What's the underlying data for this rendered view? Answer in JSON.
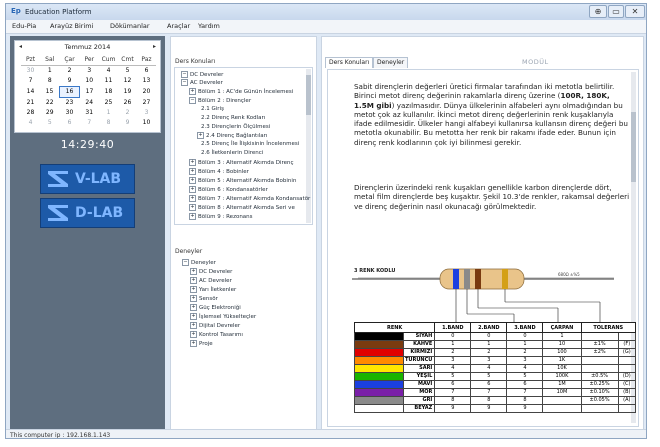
{
  "window": {
    "title": "Education Platform",
    "buttons": [
      "⊕",
      "▭",
      "✕"
    ]
  },
  "menu": [
    "Edu-Pia",
    "Arayüz Birimi",
    "Dökümanlar",
    "Araçlar",
    "Yardım"
  ],
  "calendar": {
    "month_title": "Temmuz 2014",
    "days": [
      "Pzt",
      "Sal",
      "Çar",
      "Per",
      "Cum",
      "Cmt",
      "Paz"
    ],
    "weeks": [
      [
        "30",
        "1",
        "2",
        "3",
        "4",
        "5",
        "6"
      ],
      [
        "7",
        "8",
        "9",
        "10",
        "11",
        "12",
        "13"
      ],
      [
        "14",
        "15",
        "16",
        "17",
        "18",
        "19",
        "20"
      ],
      [
        "21",
        "22",
        "23",
        "24",
        "25",
        "26",
        "27"
      ],
      [
        "28",
        "29",
        "30",
        "31",
        "1",
        "2",
        "3"
      ],
      [
        "4",
        "5",
        "6",
        "7",
        "8",
        "9",
        "10"
      ]
    ]
  },
  "clock": "14:29:40",
  "labs": [
    {
      "label": "V-LAB"
    },
    {
      "label": "D-LAB"
    }
  ],
  "course_tree": {
    "title": "Ders Konuları",
    "items": [
      {
        "text": "DC Devreler",
        "exp": "⊟"
      },
      {
        "text": "AC Devreler",
        "exp": "⊟"
      },
      {
        "text": "Bölüm 1 : AC'de Günün İncelemesi",
        "exp": "⊞"
      },
      {
        "text": "Bölüm 2 : Dirençler",
        "exp": "⊟"
      },
      {
        "text": "2.1 Giriş",
        "exp": ""
      },
      {
        "text": "2.2 Direnç Renk Kodları",
        "exp": ""
      },
      {
        "text": "2.3 Dirençlerin Ölçülmesi",
        "exp": ""
      },
      {
        "text": "2.4 Direnç Bağlantıları",
        "exp": "⊞"
      },
      {
        "text": "2.5 Direnç İle İlişkisinin İncelenmesi",
        "exp": ""
      },
      {
        "text": "2.6 İletkenlerin Direnci",
        "exp": ""
      },
      {
        "text": "Bölüm 3 : Alternatif Akımda Direnç",
        "exp": "⊞"
      },
      {
        "text": "Bölüm 4 : Bobinler",
        "exp": "⊞"
      },
      {
        "text": "Bölüm 5 : Alternatif Akımda Bobinin",
        "exp": "⊞"
      },
      {
        "text": "Bölüm 6 : Kondansatörler",
        "exp": "⊞"
      },
      {
        "text": "Bölüm 7 : Alternatif Akımda Kondansatör",
        "exp": "⊞"
      },
      {
        "text": "Bölüm 8 : Alternatif Akımda Seri ve",
        "exp": "⊞"
      },
      {
        "text": "Bölüm 9 : Rezonans",
        "exp": "⊞"
      }
    ]
  },
  "experiments_tree": {
    "title": "Deneyler",
    "items": [
      {
        "text": "Deneyler",
        "exp": "⊟"
      },
      {
        "text": "DC Devreler",
        "exp": "⊞"
      },
      {
        "text": "AC Devreler",
        "exp": "⊞"
      },
      {
        "text": "Yarı İletkenler",
        "exp": "⊞"
      },
      {
        "text": "Sensör",
        "exp": "⊞"
      },
      {
        "text": "Güç Elektroniği",
        "exp": "⊞"
      },
      {
        "text": "İşlemsel Yükselteçler",
        "exp": "⊞"
      },
      {
        "text": "Dijital Devreler",
        "exp": "⊞"
      },
      {
        "text": "Kontrol Tasarımı",
        "exp": "⊞"
      },
      {
        "text": "Proje",
        "exp": "⊞"
      }
    ]
  },
  "tabs": [
    "Ders Konuları",
    "Deneyler"
  ],
  "module_label": "MODÜL",
  "content": {
    "para1_a": "Sabit dirençlerin değerleri üretici firmalar tarafından iki metotla belirtilir. Birinci metot direnç değerinin rakamlarla direnç üzerine (",
    "para1_bold": "100R, 180K, 1.5M gibi",
    "para1_b": ") yazılmasıdır. Dünya ülkelerinin alfabeleri aynı olmadığından bu metot çok az kullanılır. İkinci metot direnç değerlerinin renk kuşaklarıyla ifade edilmesidir. Ülkeler hangi alfabeyi kullanırsa kullansın direnç değeri bu metotla okunabilir. Bu metotta her renk bir rakamı ifade eder. Bunun için direnç renk kodlarının çok iyi bilinmesi gerekir.",
    "para2": "Dirençlerin üzerindeki renk kuşakları genellikle karbon dirençlerde dört, metal film dirençlerde beş kuşaktır. Şekil 10.3'de renkler, rakamsal değerleri ve direnç değerinin nasıl okunacağı görülmektedir.",
    "resistor_label_left": "3 RENK KODLU",
    "resistor_label_right": "680Ω ±%5"
  },
  "color_table": {
    "headers": [
      "RENK",
      "1.BAND",
      "2.BAND",
      "3.BAND",
      "ÇARPAN",
      "TOLERANS"
    ],
    "rows": [
      {
        "name": "SİYAH",
        "swatch": "#000000",
        "b1": "0",
        "b2": "0",
        "b3": "0",
        "mult": "1",
        "tol": "",
        "code": ""
      },
      {
        "name": "KAHVE",
        "swatch": "#7a3b10",
        "b1": "1",
        "b2": "1",
        "b3": "1",
        "mult": "10",
        "tol": "±1%",
        "code": "(F)"
      },
      {
        "name": "KIRMIZI",
        "swatch": "#e00000",
        "b1": "2",
        "b2": "2",
        "b3": "2",
        "mult": "100",
        "tol": "±2%",
        "code": "(G)"
      },
      {
        "name": "TURUNCU",
        "swatch": "#ff8a00",
        "b1": "3",
        "b2": "3",
        "b3": "3",
        "mult": "1K",
        "tol": "",
        "code": ""
      },
      {
        "name": "SARI",
        "swatch": "#ffe600",
        "b1": "4",
        "b2": "4",
        "b3": "4",
        "mult": "10K",
        "tol": "",
        "code": ""
      },
      {
        "name": "YEŞİL",
        "swatch": "#19b400",
        "b1": "5",
        "b2": "5",
        "b3": "5",
        "mult": "100K",
        "tol": "±0.5%",
        "code": "(D)"
      },
      {
        "name": "MAVİ",
        "swatch": "#1b3fe0",
        "b1": "6",
        "b2": "6",
        "b3": "6",
        "mult": "1M",
        "tol": "±0.25%",
        "code": "(C)"
      },
      {
        "name": "MOR",
        "swatch": "#7a1fa8",
        "b1": "7",
        "b2": "7",
        "b3": "7",
        "mult": "10M",
        "tol": "±0.10%",
        "code": "(B)"
      },
      {
        "name": "GRİ",
        "swatch": "#8a8a8a",
        "b1": "8",
        "b2": "8",
        "b3": "8",
        "mult": "",
        "tol": "±0.05%",
        "code": "(A)"
      },
      {
        "name": "BEYAZ",
        "swatch": "#ffffff",
        "b1": "9",
        "b2": "9",
        "b3": "9",
        "mult": "",
        "tol": "",
        "code": ""
      }
    ]
  },
  "status": "This computer ip : 192.168.1.143"
}
